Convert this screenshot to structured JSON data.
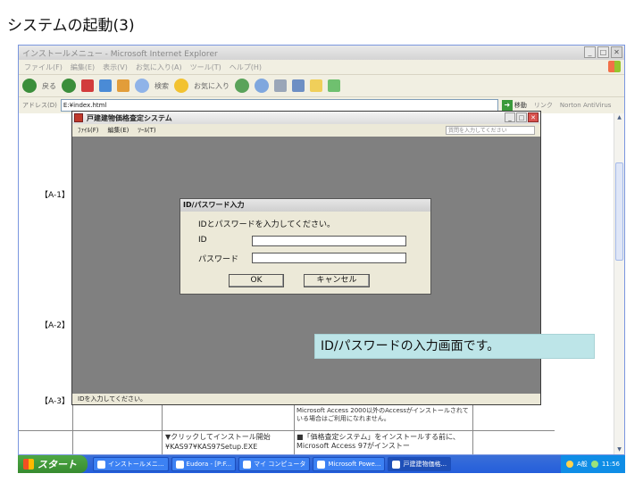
{
  "slide": {
    "title": "システムの起動(3)"
  },
  "ie": {
    "title": "インストールメニュー - Microsoft Internet Explorer",
    "menu": [
      "ファイル(F)",
      "編集(E)",
      "表示(V)",
      "お気に入り(A)",
      "ツール(T)",
      "ヘルプ(H)"
    ],
    "toolbar": {
      "back": "戻る",
      "search": "検索",
      "favorites": "お気に入り"
    },
    "address_label": "アドレス(D)",
    "address_value": "E:¥index.html",
    "go": "移動",
    "links": "リンク",
    "antivirus": "Norton AntiVirus"
  },
  "page": {
    "labels": [
      "【A-1】",
      "【A-2】",
      "【A-3】"
    ],
    "note_access": "Microsoft Access 2000以外のAccessがインストールされている場合はご利用になれません。",
    "click_install": "▼クリックしてインストール開始",
    "setup_path": "¥KAS97¥KAS97Setup.EXE",
    "kakaku_install": "■「価格査定システム」をインストールする前に、Microsoft Access 97がインストー"
  },
  "app": {
    "title": "戸建建物価格査定システム",
    "menu": [
      "ﾌｧｲﾙ(F)",
      "編集(E)",
      "ﾂｰﾙ(T)"
    ],
    "help_placeholder": "質問を入力してください",
    "status": "IDを入力してください。"
  },
  "dialog": {
    "title": "ID/パスワード入力",
    "prompt": "IDとパスワードを入力してください。",
    "id_label": "ID",
    "password_label": "パスワード",
    "ok": "OK",
    "cancel": "キャンセル"
  },
  "callout": "ID/パスワードの入力画面です。",
  "taskbar": {
    "start": "スタート",
    "tasks": [
      "インストールメニ...",
      "Eudora - [P:F...",
      "マイ コンピュータ",
      "Microsoft Powe...",
      "戸建建物価格..."
    ],
    "ime": "A般",
    "clock": "11:56"
  }
}
